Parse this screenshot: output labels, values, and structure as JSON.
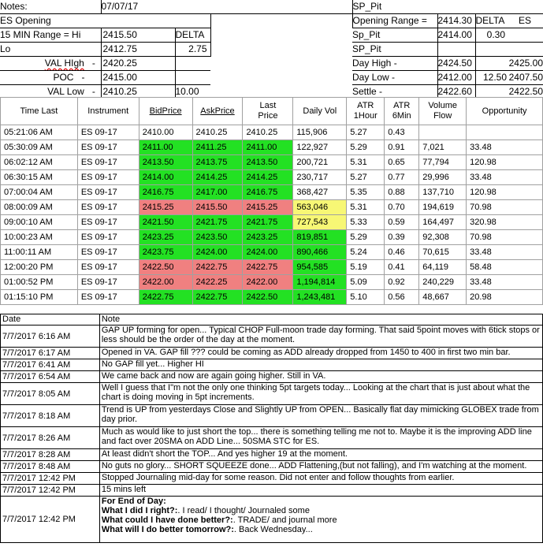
{
  "header": {
    "notes_label": "Notes:",
    "date": "07/07/17",
    "left": {
      "opening": "ES Opening",
      "range_label": "15 MIN Range = Hi",
      "hi": "2415.50",
      "delta": "DELTA",
      "lo_label": "Lo",
      "lo": "2412.75",
      "lo_delta": "2.75",
      "val_high_label": "VAL HIgh",
      "val_high": "2420.25",
      "poc_label": "POC",
      "poc": "2415.00",
      "val_low_label": "VAL Low",
      "val_low": "2410.25",
      "val_low_delta": "10.00",
      "dash": "-"
    },
    "right": {
      "sp_pit": "SP_Pit",
      "opening_range_label": "Opening Range =",
      "opening_range": "2414.30",
      "delta": "DELTA",
      "es": "ES",
      "sp_pit_2": "Sp_Pit",
      "sp_pit_val": "2414.00",
      "sp_pit_delta": "0.30",
      "sp_pit_3": "SP_Pit",
      "day_high_label": "Day High -",
      "day_high": "2424.50",
      "day_high_es": "2425.00",
      "day_low_label": "Day Low -",
      "day_low": "2412.00",
      "day_low_delta": "12.50",
      "day_low_es": "2407.50",
      "settle_label": "Settle -",
      "settle": "2422.60",
      "settle_es": "2422.50"
    }
  },
  "grid": {
    "columns": [
      "Time Last",
      "Instrument",
      "BidPrice",
      "AskPrice",
      "Last Price",
      "Daily Vol",
      "ATR 1Hour",
      "ATR 6Min",
      "Volume Flow",
      "Opportunity"
    ],
    "rows": [
      {
        "time": "05:21:06 AM",
        "inst": "ES 09-17",
        "bid": "2410.00",
        "ask": "2410.25",
        "last": "2410.25",
        "vol": "115,906",
        "atr1": "5.27",
        "atr6": "0.43",
        "flow": "",
        "opp": "",
        "color": "none",
        "volcolor": "none"
      },
      {
        "time": "05:30:09 AM",
        "inst": "ES 09-17",
        "bid": "2411.00",
        "ask": "2411.25",
        "last": "2411.00",
        "vol": "122,927",
        "atr1": "5.29",
        "atr6": "0.91",
        "flow": "7,021",
        "opp": "33.48",
        "color": "green",
        "volcolor": "none"
      },
      {
        "time": "06:02:12 AM",
        "inst": "ES 09-17",
        "bid": "2413.50",
        "ask": "2413.75",
        "last": "2413.50",
        "vol": "200,721",
        "atr1": "5.31",
        "atr6": "0.65",
        "flow": "77,794",
        "opp": "120.98",
        "color": "green",
        "volcolor": "none"
      },
      {
        "time": "06:30:15 AM",
        "inst": "ES 09-17",
        "bid": "2414.00",
        "ask": "2414.25",
        "last": "2414.25",
        "vol": "230,717",
        "atr1": "5.27",
        "atr6": "0.77",
        "flow": "29,996",
        "opp": "33.48",
        "color": "green",
        "volcolor": "none"
      },
      {
        "time": "07:00:04 AM",
        "inst": "ES 09-17",
        "bid": "2416.75",
        "ask": "2417.00",
        "last": "2416.75",
        "vol": "368,427",
        "atr1": "5.35",
        "atr6": "0.88",
        "flow": "137,710",
        "opp": "120.98",
        "color": "green",
        "volcolor": "none"
      },
      {
        "time": "08:00:09 AM",
        "inst": "ES 09-17",
        "bid": "2415.25",
        "ask": "2415.50",
        "last": "2415.25",
        "vol": "563,046",
        "atr1": "5.31",
        "atr6": "0.70",
        "flow": "194,619",
        "opp": "70.98",
        "color": "red",
        "volcolor": "yellow"
      },
      {
        "time": "09:00:10 AM",
        "inst": "ES 09-17",
        "bid": "2421.50",
        "ask": "2421.75",
        "last": "2421.75",
        "vol": "727,543",
        "atr1": "5.33",
        "atr6": "0.59",
        "flow": "164,497",
        "opp": "320.98",
        "color": "green",
        "volcolor": "yellow"
      },
      {
        "time": "10:00:23 AM",
        "inst": "ES 09-17",
        "bid": "2423.25",
        "ask": "2423.50",
        "last": "2423.25",
        "vol": "819,851",
        "atr1": "5.29",
        "atr6": "0.39",
        "flow": "92,308",
        "opp": "70.98",
        "color": "green",
        "volcolor": "green"
      },
      {
        "time": "11:00:11 AM",
        "inst": "ES 09-17",
        "bid": "2423.75",
        "ask": "2424.00",
        "last": "2424.00",
        "vol": "890,466",
        "atr1": "5.24",
        "atr6": "0.46",
        "flow": "70,615",
        "opp": "33.48",
        "color": "green",
        "volcolor": "green"
      },
      {
        "time": "12:00:20 PM",
        "inst": "ES 09-17",
        "bid": "2422.50",
        "ask": "2422.75",
        "last": "2422.75",
        "vol": "954,585",
        "atr1": "5.19",
        "atr6": "0.41",
        "flow": "64,119",
        "opp": "58.48",
        "color": "red",
        "volcolor": "green"
      },
      {
        "time": "01:00:52 PM",
        "inst": "ES 09-17",
        "bid": "2422.00",
        "ask": "2422.25",
        "last": "2422.00",
        "vol": "1,194,814",
        "atr1": "5.09",
        "atr6": "0.92",
        "flow": "240,229",
        "opp": "33.48",
        "color": "red",
        "volcolor": "green"
      },
      {
        "time": "01:15:10 PM",
        "inst": "ES 09-17",
        "bid": "2422.75",
        "ask": "2422.75",
        "last": "2422.50",
        "vol": "1,243,481",
        "atr1": "5.10",
        "atr6": "0.56",
        "flow": "48,667",
        "opp": "20.98",
        "color": "green",
        "volcolor": "green"
      }
    ]
  },
  "log": {
    "date_header": "Date",
    "note_header": "Note",
    "entries": [
      {
        "date": "7/7/2017 6:16 AM",
        "note": "GAP UP forming for open... Typical CHOP Full-moon trade day forming.  That said 5point moves with 6tick stops or less should be the order of the day at the moment."
      },
      {
        "date": "7/7/2017 6:17 AM",
        "note": "Opened in VA.  GAP fill ??? could be coming as ADD already dropped from 1450 to 400 in first two min bar."
      },
      {
        "date": "7/7/2017 6:41 AM",
        "note": "No GAP fill yet... Higher HI"
      },
      {
        "date": "7/7/2017 6:54 AM",
        "note": "We came back and now are again going higher.  Still in VA."
      },
      {
        "date": "7/7/2017 8:05 AM",
        "note": "Well I guess that I\"m not the only one thinking 5pt targets today... Looking at the chart that is just about what the chart is doing moving in 5pt increments."
      },
      {
        "date": "7/7/2017 8:18 AM",
        "note": "Trend is UP from yesterdays Close and Slightly UP from OPEN... Basically flat day mimicking GLOBEX trade from day prior."
      },
      {
        "date": "7/7/2017 8:26 AM",
        "note": "Much as would like to just short the top... there is something telling me not to.  Maybe it is the improving ADD line and fact over 20SMA on ADD Line... 50SMA STC for ES."
      },
      {
        "date": "7/7/2017 8:28 AM",
        "note": "At least didn't short the TOP... And yes higher 19 at the moment."
      },
      {
        "date": "7/7/2017 8:48 AM",
        "note": "No guts no glory... SHORT SQUEEZE done... ADD Flattening,(but not falling), and I'm watching at the moment."
      },
      {
        "date": "7/7/2017 12:42 PM",
        "note": "Stopped Journaling mid-day for some reason.  Did not enter and follow thoughts from earlier."
      },
      {
        "date": "7/7/2017 12:42 PM",
        "note": "15 mins left"
      }
    ],
    "final": {
      "date": "7/7/2017 12:42 PM",
      "title": "For End of Day:",
      "q1": "What I did I right?:",
      "a1": ". I read/ I thought/ Journaled some",
      "q2": "What could I have done better?:",
      "a2": ". TRADE/ and journal more",
      "q3": "What will I do better tomorrow?:",
      "a3": ". Back Wednesday..."
    }
  },
  "colors": {
    "green": "#23e123",
    "red": "#f08080",
    "yellow": "#f7f775"
  }
}
